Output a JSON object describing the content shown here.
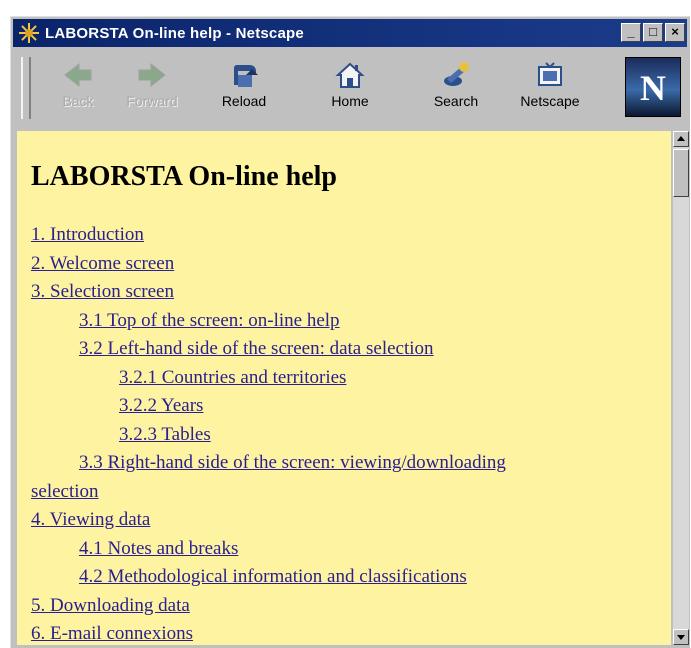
{
  "window": {
    "title": "LABORSTA On-line help - Netscape",
    "controls": {
      "minimize": "_",
      "maximize": "□",
      "close": "×"
    }
  },
  "toolbar": {
    "buttons": [
      {
        "label": "Back",
        "icon": "back-arrow-icon",
        "enabled": false
      },
      {
        "label": "Forward",
        "icon": "forward-arrow-icon",
        "enabled": false
      },
      {
        "label": "Reload",
        "icon": "reload-icon",
        "enabled": true
      },
      {
        "label": "Home",
        "icon": "home-icon",
        "enabled": true
      },
      {
        "label": "Search",
        "icon": "search-icon",
        "enabled": true
      },
      {
        "label": "Netscape",
        "icon": "netscape-icon",
        "enabled": true
      }
    ],
    "logo_letter": "N"
  },
  "page": {
    "title": "LABORSTA On-line help",
    "toc": [
      {
        "text": "1. Introduction",
        "level": 0
      },
      {
        "text": "2. Welcome screen",
        "level": 0
      },
      {
        "text": "3. Selection screen",
        "level": 0
      },
      {
        "text": "3.1 Top of the screen: on-line help",
        "level": 1
      },
      {
        "text": "3.2 Left-hand side of the screen: data selection",
        "level": 1
      },
      {
        "text": "3.2.1 Countries and territories",
        "level": 2
      },
      {
        "text": "3.2.2 Years",
        "level": 2
      },
      {
        "text": "3.2.3 Tables",
        "level": 2
      },
      {
        "text": "3.3 Right-hand side of the screen: viewing/downloading",
        "level": 1
      },
      {
        "text": "selection",
        "level": 0
      },
      {
        "text": "4. Viewing data",
        "level": 0
      },
      {
        "text": "4.1 Notes and breaks",
        "level": 1
      },
      {
        "text": "4.2 Methodological information and classifications",
        "level": 1
      },
      {
        "text": "5. Downloading data",
        "level": 0
      },
      {
        "text": "6. E-mail connexions",
        "level": 0
      }
    ]
  },
  "colors": {
    "page_background": "#fef3a1",
    "link": "#2a2090",
    "titlebar": "#0a246a"
  }
}
